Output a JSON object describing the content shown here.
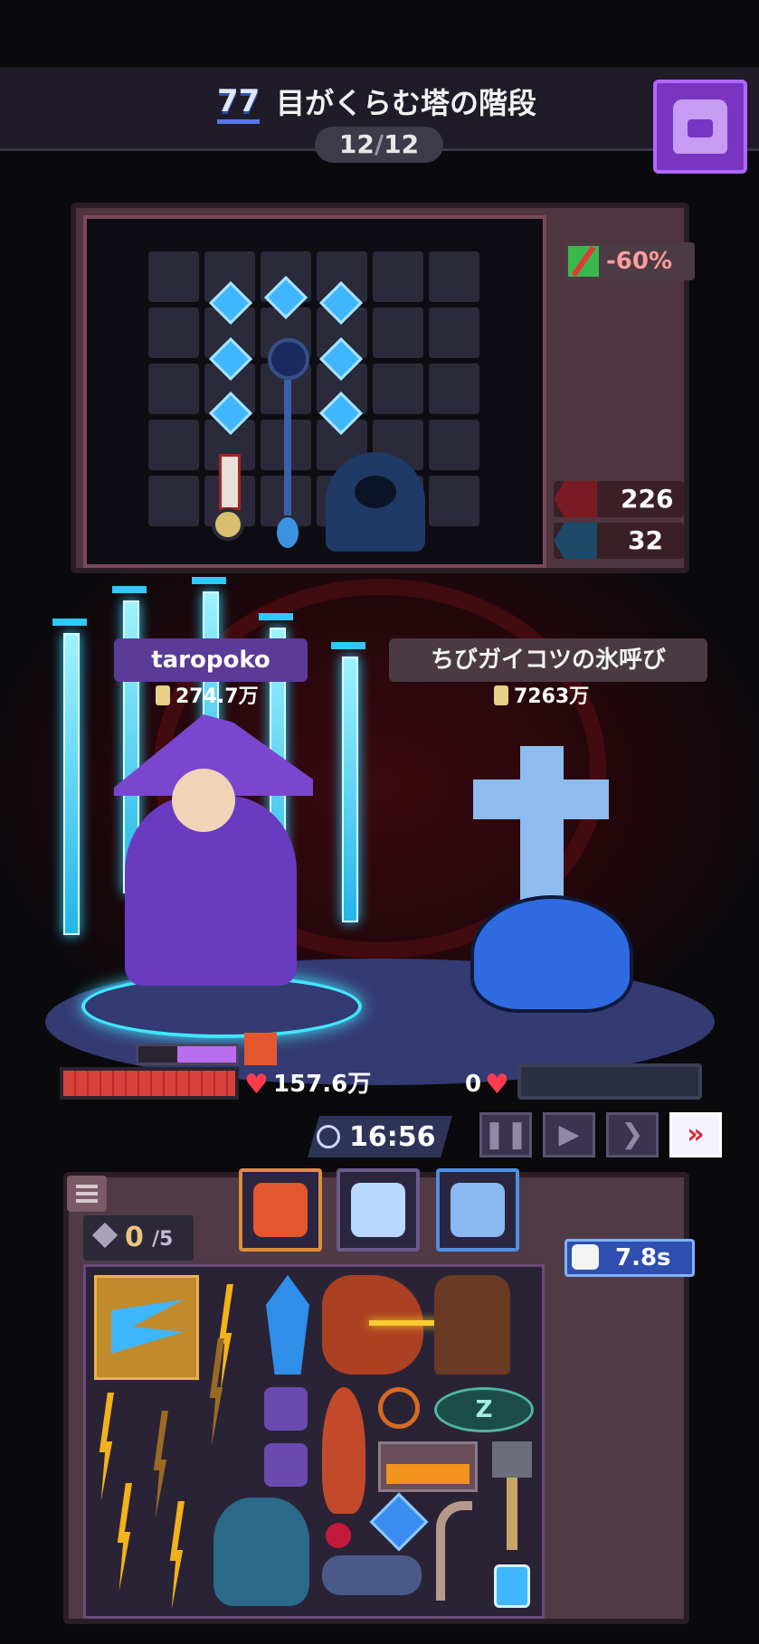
{
  "header": {
    "stage_number": "77",
    "stage_title": "目がくらむ塔の階段",
    "wave_current": "12",
    "wave_separator": "/",
    "wave_total": "12",
    "bag_button_icon": "backpack-icon"
  },
  "top_chest": {
    "debuff_icon": "no-heal-icon",
    "debuff_value": "-60%",
    "stats": [
      {
        "icon": "attack-fist-icon",
        "value": "226"
      },
      {
        "icon": "defense-gear-icon",
        "value": "32"
      }
    ]
  },
  "player": {
    "name": "taropoko",
    "power": "274.7万",
    "hp": "157.6万",
    "hp_fraction": 1.0,
    "shield_fraction": 0.6
  },
  "enemy": {
    "name": "ちびガイコツの氷呼び",
    "power": "7263万",
    "hp": "0",
    "hp_fraction": 0.0
  },
  "battle": {
    "timer": "16:56",
    "controls": [
      {
        "name": "pause-button",
        "icon": "pause-icon",
        "glyph": "❚❚"
      },
      {
        "name": "play-button",
        "icon": "play-icon",
        "glyph": "▶"
      },
      {
        "name": "fast-button",
        "icon": "fast-forward-icon",
        "glyph": "❯"
      },
      {
        "name": "fastest-button",
        "icon": "double-chevron-icon",
        "glyph": "»"
      }
    ]
  },
  "backpack": {
    "slot_count": "0",
    "slot_max": "/5",
    "cooldown": "7.8s",
    "pet_cards": [
      "dragon-pet-icon",
      "ghost-pet-icon",
      "wolf-pet-icon"
    ]
  },
  "colors": {
    "accent_purple": "#7a34c2",
    "hp_red": "#d9423c",
    "ice_blue": "#3fb6ff",
    "fast_button_red": "#d4283c"
  }
}
